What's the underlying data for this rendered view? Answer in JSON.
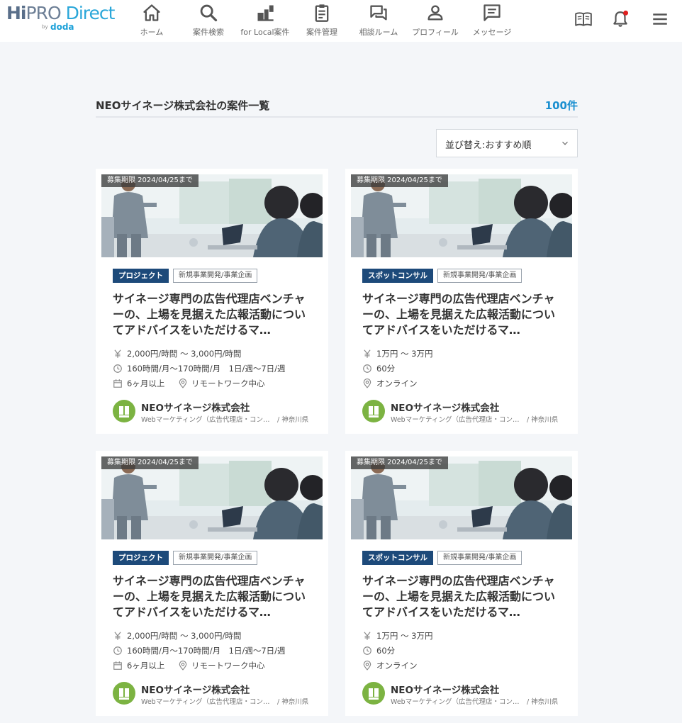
{
  "header": {
    "logo": {
      "hi": "Hi",
      "pro": "PRO",
      "direct": " Direct",
      "by": "by",
      "doda": "doda"
    },
    "nav": [
      {
        "label": "ホーム",
        "icon": "home-icon"
      },
      {
        "label": "案件検索",
        "icon": "search-icon"
      },
      {
        "label": "for Local案件",
        "icon": "local-icon"
      },
      {
        "label": "案件管理",
        "icon": "clipboard-icon"
      },
      {
        "label": "相談ルーム",
        "icon": "chat-icon"
      },
      {
        "label": "プロフィール",
        "icon": "person-icon"
      },
      {
        "label": "メッセージ",
        "icon": "message-icon"
      }
    ],
    "right_icons": [
      "guide-book-icon",
      "notification-bell-icon",
      "hamburger-menu-icon"
    ],
    "notification_color": "#e02020"
  },
  "section": {
    "title": "NEOサイネージ株式会社の案件一覧",
    "count": "100件",
    "sort_label": "並び替え:おすすめ順"
  },
  "colors": {
    "accent": "#1a8fd0",
    "tag_type_bg": "#1d4a7a",
    "company_logo": "#7cb342"
  },
  "cards": [
    {
      "deadline": "募集期限 2024/04/25まで",
      "type_tag": "プロジェクト",
      "category_tag": "新規事業開発/事業企画",
      "title": "サイネージ専門の広告代理店ベンチャーの、上場を見据えた広報活動についてアドバイスをいただけるマ…",
      "fee": "2,000円/時間 〜 3,000円/時間",
      "time": "160時間/月〜170時間/月　1日/週〜7日/週",
      "period": "6ヶ月以上",
      "location": "リモートワーク中心",
      "company_name": "NEOサイネージ株式会社",
      "company_desc": "Webマーケティング（広告代理店・コンサルティング）",
      "company_pref": "/ 神奈川県"
    },
    {
      "deadline": "募集期限 2024/04/25まで",
      "type_tag": "スポットコンサル",
      "category_tag": "新規事業開発/事業企画",
      "title": "サイネージ専門の広告代理店ベンチャーの、上場を見据えた広報活動についてアドバイスをいただけるマ…",
      "fee": "1万円 〜 3万円",
      "time": "60分",
      "location": "オンライン",
      "company_name": "NEOサイネージ株式会社",
      "company_desc": "Webマーケティング（広告代理店・コンサルティング）",
      "company_pref": "/ 神奈川県"
    },
    {
      "deadline": "募集期限 2024/04/25まで",
      "type_tag": "プロジェクト",
      "category_tag": "新規事業開発/事業企画",
      "title": "サイネージ専門の広告代理店ベンチャーの、上場を見据えた広報活動についてアドバイスをいただけるマ…",
      "fee": "2,000円/時間 〜 3,000円/時間",
      "time": "160時間/月〜170時間/月　1日/週〜7日/週",
      "period": "6ヶ月以上",
      "location": "リモートワーク中心",
      "company_name": "NEOサイネージ株式会社",
      "company_desc": "Webマーケティング（広告代理店・コンサルティング）",
      "company_pref": "/ 神奈川県"
    },
    {
      "deadline": "募集期限 2024/04/25まで",
      "type_tag": "スポットコンサル",
      "category_tag": "新規事業開発/事業企画",
      "title": "サイネージ専門の広告代理店ベンチャーの、上場を見据えた広報活動についてアドバイスをいただけるマ…",
      "fee": "1万円 〜 3万円",
      "time": "60分",
      "location": "オンライン",
      "company_name": "NEOサイネージ株式会社",
      "company_desc": "Webマーケティング（広告代理店・コンサルティング）",
      "company_pref": "/ 神奈川県"
    }
  ]
}
